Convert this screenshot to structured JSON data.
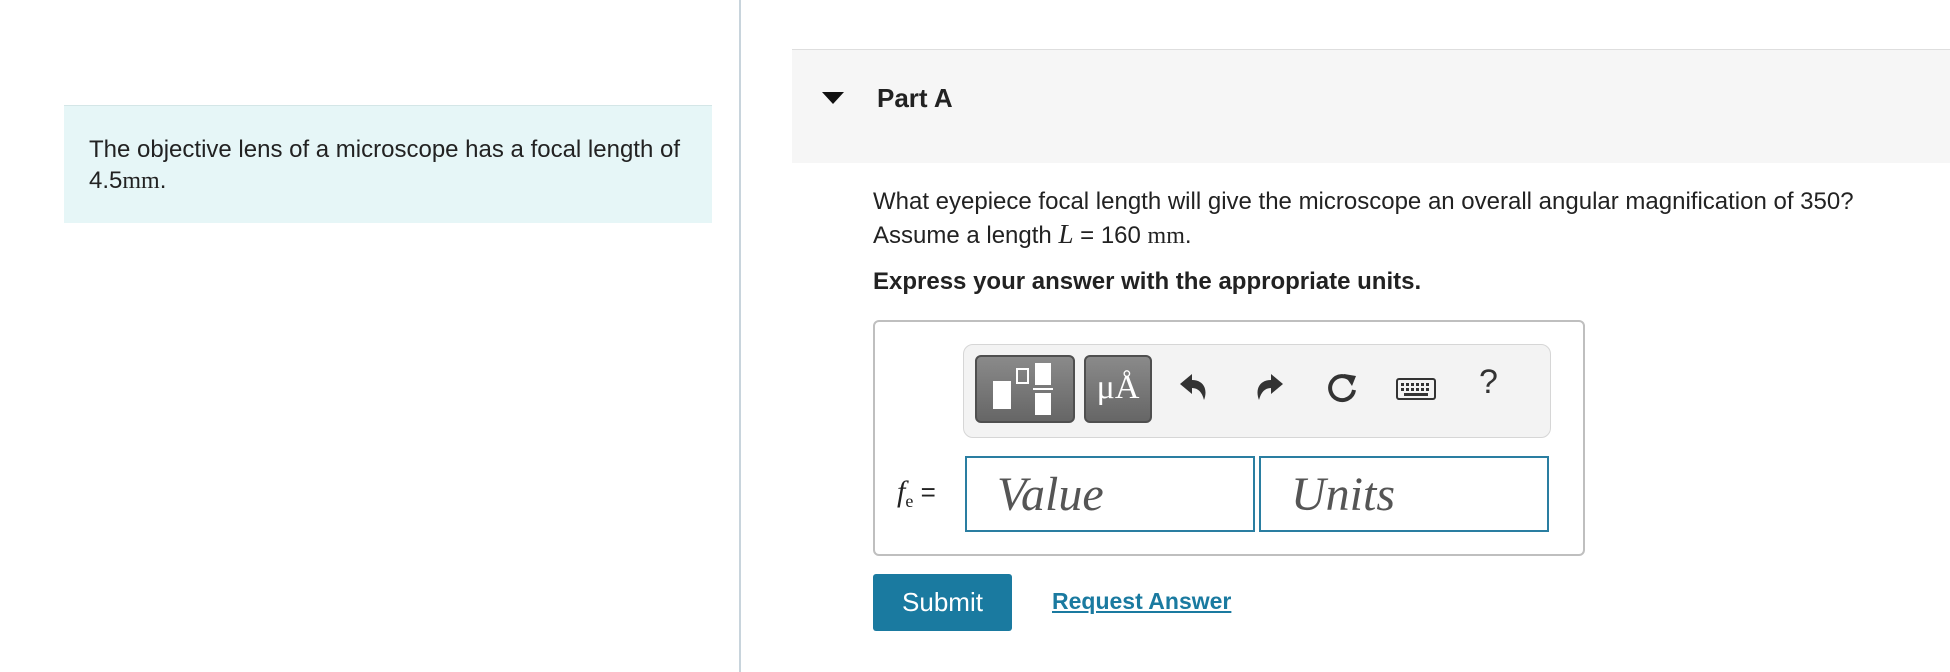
{
  "problem": {
    "text_before": "The objective lens of a microscope has a focal length of 4.5",
    "unit": "mm",
    "text_after": "."
  },
  "part": {
    "title": "Part A"
  },
  "question": {
    "line1": "What eyepiece focal length will give the microscope an overall angular magnification of 350?",
    "line2_before": "Assume a length ",
    "variable": "L",
    "equals_value": " = 160 ",
    "unit": "mm",
    "line2_after": "."
  },
  "instruction": "Express your answer with the appropriate units.",
  "toolbar": {
    "icons": [
      "templates-icon",
      "units-icon",
      "undo-icon",
      "redo-icon",
      "reset-icon",
      "keyboard-icon",
      "help-icon"
    ],
    "units_glyph": "μÅ",
    "help_label": "?"
  },
  "answer": {
    "variable": "f",
    "subscript": "e",
    "equals": "=",
    "value_placeholder": "Value",
    "units_placeholder": "Units"
  },
  "actions": {
    "submit_label": "Submit",
    "request_label": "Request Answer"
  },
  "colors": {
    "accent": "#1a7aa0",
    "problem_bg": "#e6f6f7",
    "header_bg": "#f6f6f6"
  }
}
